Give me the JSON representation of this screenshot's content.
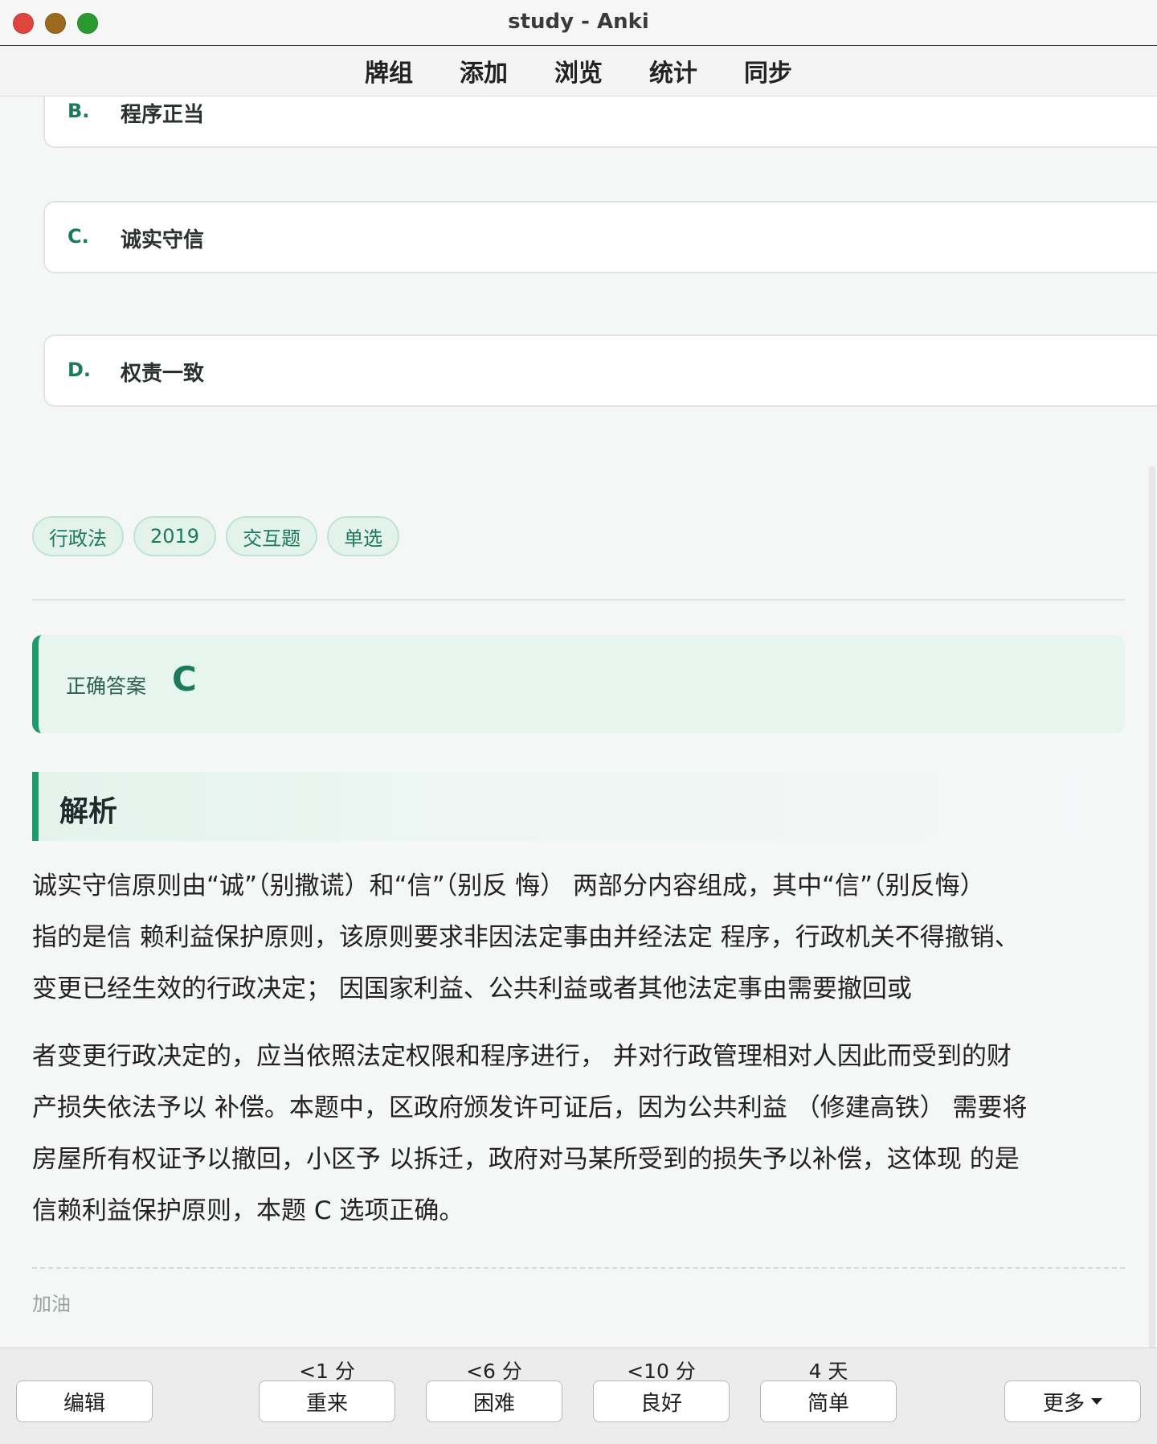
{
  "window": {
    "title": "study - Anki"
  },
  "toolbar": {
    "items": [
      "牌组",
      "添加",
      "浏览",
      "统计",
      "同步"
    ]
  },
  "options": [
    {
      "letter": "B.",
      "text": "程序正当"
    },
    {
      "letter": "C.",
      "text": "诚实守信"
    },
    {
      "letter": "D.",
      "text": "权责一致"
    }
  ],
  "tags": [
    "行政法",
    "2019",
    "交互题",
    "单选"
  ],
  "answer": {
    "label": "正确答案",
    "value": "C"
  },
  "analysis": {
    "heading": "解析",
    "para1_lines": [
      "诚实守信原则由“诚”（别撒谎）和“信”（别反 悔） 两部分内容组成，其中“信”（别反悔）",
      "指的是信 赖利益保护原则，该原则要求非因法定事由并经法定 程序，行政机关不得撤销、",
      "变更已经生效的行政决定； 因国家利益、公共利益或者其他法定事由需要撤回或"
    ],
    "para2_lines": [
      "者变更行政决定的，应当依照法定权限和程序进行， 并对行政管理相对人因此而受到的财",
      "产损失依法予以 补偿。本题中，区政府颁发许可证后，因为公共利益 （修建高铁） 需要将",
      "房屋所有权证予以撤回，小区予 以拆迁，政府对马某所受到的损失予以补偿，这体现 的是",
      "信赖利益保护原则，本题 C 选项正确。"
    ]
  },
  "footer_note": "加油",
  "bottom": {
    "edit": "编辑",
    "answers": [
      {
        "due": "<1 分",
        "label": "重来"
      },
      {
        "due": "<6 分",
        "label": "困难"
      },
      {
        "due": "<10 分",
        "label": "良好"
      },
      {
        "due": "4 天",
        "label": "简单"
      }
    ],
    "more": "更多"
  }
}
